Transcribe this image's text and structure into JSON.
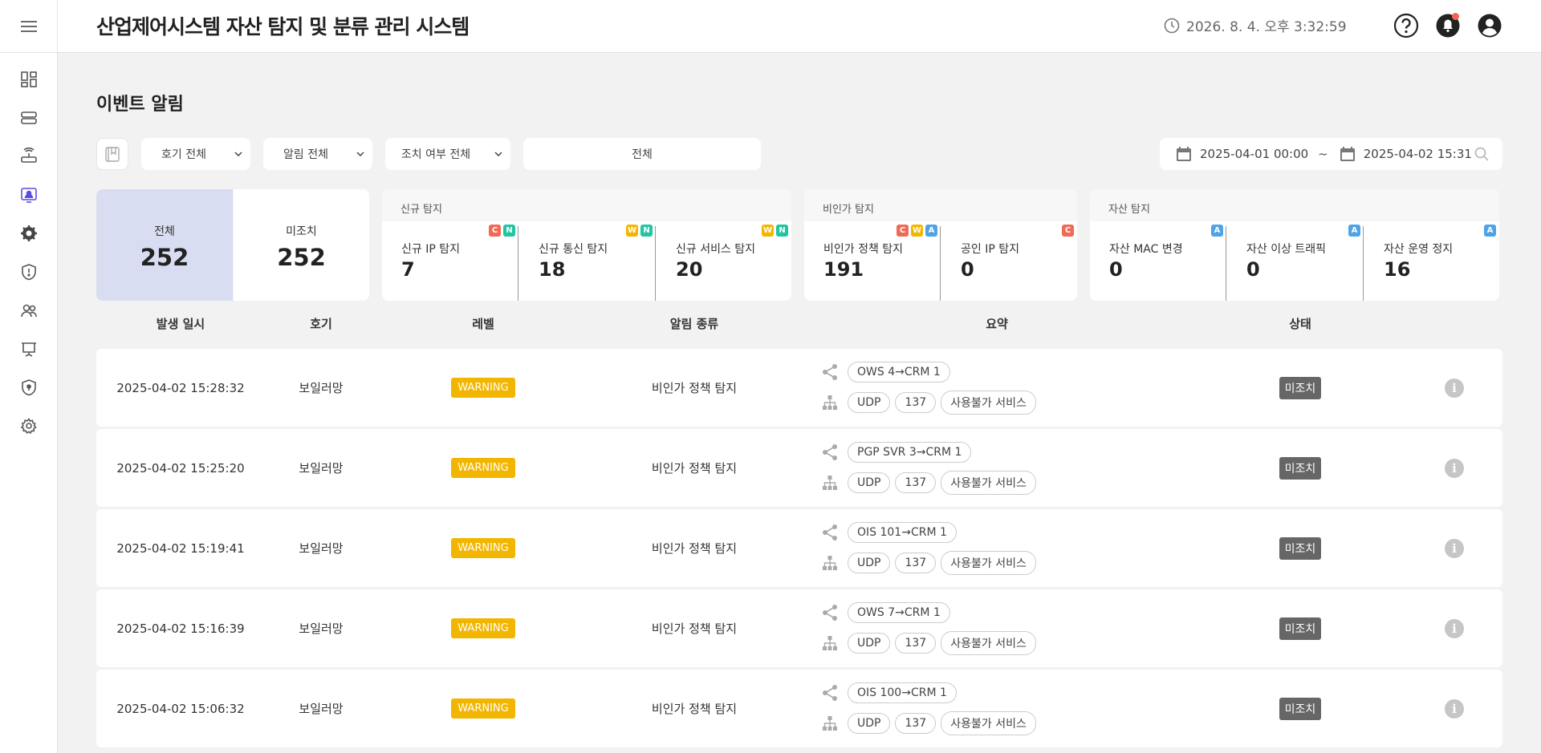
{
  "header": {
    "title": "산업제어시스템 자산 탐지 및 분류 관리 시스템",
    "datetime": "2026. 8. 4. 오후 3:32:59"
  },
  "page": {
    "title": "이벤트 알림"
  },
  "filters": {
    "unit": "호기 전체",
    "alert": "알림 전체",
    "action": "조치 여부 전체",
    "keyword": "전체",
    "date_from": "2025-04-01 00:00",
    "date_sep": "~",
    "date_to": "2025-04-02 15:31"
  },
  "summary": {
    "total": {
      "label": "전체",
      "value": "252"
    },
    "pending": {
      "label": "미조치",
      "value": "252"
    },
    "groups": [
      {
        "title": "신규 탐지",
        "metrics": [
          {
            "label": "신규 IP 탐지",
            "value": "7",
            "badges": [
              "C",
              "N"
            ]
          },
          {
            "label": "신규 통신 탐지",
            "value": "18",
            "badges": [
              "W",
              "N"
            ]
          },
          {
            "label": "신규 서비스 탐지",
            "value": "20",
            "badges": [
              "W",
              "N"
            ]
          }
        ]
      },
      {
        "title": "비인가 탐지",
        "metrics": [
          {
            "label": "비인가 정책 탐지",
            "value": "191",
            "badges": [
              "C",
              "W",
              "A"
            ]
          },
          {
            "label": "공인 IP 탐지",
            "value": "0",
            "badges": [
              "C"
            ]
          }
        ]
      },
      {
        "title": "자산 탐지",
        "metrics": [
          {
            "label": "자산 MAC 변경",
            "value": "0",
            "badges": [
              "A"
            ]
          },
          {
            "label": "자산 이상 트래픽",
            "value": "0",
            "badges": [
              "A"
            ]
          },
          {
            "label": "자산 운영 정지",
            "value": "16",
            "badges": [
              "A"
            ]
          }
        ]
      }
    ]
  },
  "badge_colors": {
    "C": "#ef6b55",
    "N": "#20c5a2",
    "W": "#f3b600",
    "A": "#4fa3e6"
  },
  "table": {
    "columns": [
      "발생 일시",
      "호기",
      "레벨",
      "알림 종류",
      "요약",
      "상태"
    ],
    "rows": [
      {
        "datetime": "2025-04-02 15:28:32",
        "unit": "보일러망",
        "level": "WARNING",
        "type": "비인가 정책 탐지",
        "route": "OWS 4→CRM 1",
        "protocol": "UDP",
        "port": "137",
        "service": "사용불가 서비스",
        "status": "미조치"
      },
      {
        "datetime": "2025-04-02 15:25:20",
        "unit": "보일러망",
        "level": "WARNING",
        "type": "비인가 정책 탐지",
        "route": "PGP SVR 3→CRM 1",
        "protocol": "UDP",
        "port": "137",
        "service": "사용불가 서비스",
        "status": "미조치"
      },
      {
        "datetime": "2025-04-02 15:19:41",
        "unit": "보일러망",
        "level": "WARNING",
        "type": "비인가 정책 탐지",
        "route": "OIS 101→CRM 1",
        "protocol": "UDP",
        "port": "137",
        "service": "사용불가 서비스",
        "status": "미조치"
      },
      {
        "datetime": "2025-04-02 15:16:39",
        "unit": "보일러망",
        "level": "WARNING",
        "type": "비인가 정책 탐지",
        "route": "OWS 7→CRM 1",
        "protocol": "UDP",
        "port": "137",
        "service": "사용불가 서비스",
        "status": "미조치"
      },
      {
        "datetime": "2025-04-02 15:06:32",
        "unit": "보일러망",
        "level": "WARNING",
        "type": "비인가 정책 탐지",
        "route": "OIS 100→CRM 1",
        "protocol": "UDP",
        "port": "137",
        "service": "사용불가 서비스",
        "status": "미조치"
      }
    ]
  },
  "colors": {
    "accent": "#5b4de0",
    "total_card": "#d8ddf1",
    "warning": "#f3b600",
    "status": "#666666"
  }
}
